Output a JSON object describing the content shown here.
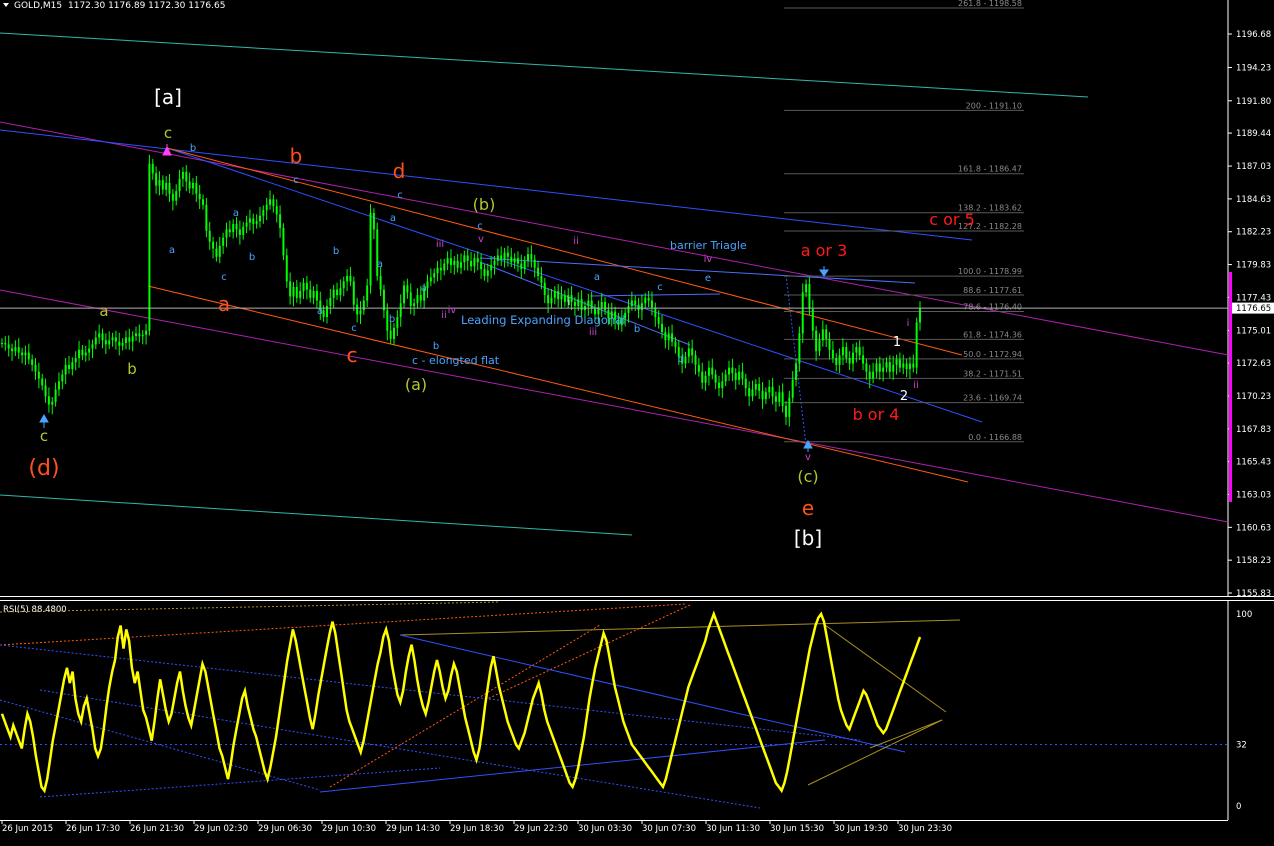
{
  "window": {
    "title": "GOLD,M15",
    "ohlc": "1172.30 1176.89 1172.30 1176.65",
    "menu_icon": "triangle-down-icon"
  },
  "colors": {
    "background": "#000000",
    "candle": "#00ff00",
    "axis": "#ffffff",
    "rsi_line": "#ffff00",
    "current_price_bg": "#ffffff",
    "fib_line": "#6e6e6e",
    "sidebar_marker": "#ff00ff"
  },
  "chart_data": [
    {
      "type": "candlestick",
      "title": "GOLD,M15",
      "ylim": [
        1155.83,
        1199.5
      ],
      "price_axis_ticks": [
        "1196.68",
        "1194.23",
        "1191.80",
        "1189.44",
        "1187.03",
        "1184.63",
        "1182.23",
        "1179.83",
        "1177.43",
        "1175.01",
        "1172.63",
        "1170.23",
        "1167.83",
        "1165.43",
        "1163.03",
        "1160.63",
        "1158.23",
        "1155.83"
      ],
      "current_price": "1176.65",
      "current_price_value": 1176.65,
      "time_labels": [
        "26 Jun 2015",
        "26 Jun 17:30",
        "26 Jun 21:30",
        "29 Jun 02:30",
        "29 Jun 06:30",
        "29 Jun 10:30",
        "29 Jun 14:30",
        "29 Jun 18:30",
        "29 Jun 22:30",
        "30 Jun 03:30",
        "30 Jun 07:30",
        "30 Jun 11:30",
        "30 Jun 15:30",
        "30 Jun 19:30",
        "30 Jun 23:30"
      ],
      "close_series": [
        1174.1,
        1174.0,
        1173.7,
        1173.5,
        1173.8,
        1173.4,
        1173.2,
        1173.4,
        1172.9,
        1172.5,
        1172.0,
        1171.5,
        1171.0,
        1170.2,
        1169.6,
        1169.8,
        1170.7,
        1171.3,
        1171.8,
        1172.5,
        1172.2,
        1172.7,
        1173.0,
        1173.6,
        1173.2,
        1173.4,
        1173.7,
        1174.0,
        1174.5,
        1174.8,
        1174.3,
        1174.0,
        1174.3,
        1174.5,
        1174.2,
        1173.9,
        1174.1,
        1174.5,
        1174.2,
        1174.6,
        1174.8,
        1174.6,
        1174.7,
        1175.0,
        1187.2,
        1186.5,
        1185.6,
        1186.0,
        1185.3,
        1185.8,
        1185.0,
        1184.5,
        1185.2,
        1186.1,
        1186.6,
        1185.9,
        1185.4,
        1185.8,
        1185.0,
        1184.6,
        1184.2,
        1182.3,
        1181.5,
        1181.0,
        1180.4,
        1181.2,
        1181.8,
        1182.4,
        1182.2,
        1182.8,
        1182.4,
        1182.0,
        1182.6,
        1182.9,
        1183.2,
        1182.8,
        1183.0,
        1183.4,
        1183.8,
        1184.2,
        1184.6,
        1184.1,
        1183.5,
        1182.5,
        1180.5,
        1178.6,
        1177.5,
        1178.2,
        1177.4,
        1177.9,
        1178.5,
        1178.0,
        1177.4,
        1177.9,
        1177.2,
        1176.5,
        1176.0,
        1176.8,
        1177.4,
        1178.0,
        1177.6,
        1178.1,
        1178.6,
        1179.0,
        1178.6,
        1176.9,
        1176.2,
        1176.5,
        1177.2,
        1178.3,
        1183.6,
        1182.4,
        1179.0,
        1178.0,
        1176.5,
        1175.0,
        1174.4,
        1175.2,
        1176.0,
        1177.0,
        1178.3,
        1177.8,
        1176.8,
        1177.0,
        1177.6,
        1177.2,
        1178.1,
        1178.6,
        1178.9,
        1179.2,
        1179.6,
        1179.4,
        1179.9,
        1180.3,
        1179.8,
        1180.1,
        1179.6,
        1180.0,
        1180.5,
        1180.1,
        1179.7,
        1180.3,
        1180.0,
        1179.5,
        1179.0,
        1179.4,
        1179.8,
        1180.1,
        1180.5,
        1180.2,
        1180.7,
        1180.4,
        1180.0,
        1180.3,
        1179.9,
        1179.5,
        1180.1,
        1180.6,
        1180.2,
        1179.6,
        1179.0,
        1178.5,
        1177.6,
        1177.0,
        1177.4,
        1177.9,
        1177.3,
        1177.6,
        1177.1,
        1177.6,
        1177.1,
        1176.8,
        1177.3,
        1176.5,
        1176.8,
        1177.2,
        1176.6,
        1176.2,
        1176.7,
        1177.1,
        1176.5,
        1175.9,
        1176.4,
        1175.8,
        1175.4,
        1175.9,
        1176.3,
        1176.8,
        1177.2,
        1176.9,
        1176.5,
        1177.0,
        1177.4,
        1177.2,
        1176.7,
        1176.0,
        1175.5,
        1174.9,
        1174.3,
        1174.8,
        1174.2,
        1173.8,
        1173.1,
        1172.6,
        1173.1,
        1173.7,
        1173.2,
        1172.5,
        1172.0,
        1171.2,
        1171.7,
        1172.3,
        1171.8,
        1171.2,
        1170.8,
        1171.3,
        1171.8,
        1172.3,
        1171.9,
        1171.4,
        1172.0,
        1171.5,
        1170.8,
        1170.2,
        1170.7,
        1171.1,
        1170.6,
        1170.0,
        1170.5,
        1170.9,
        1170.2,
        1169.8,
        1170.5,
        1169.5,
        1168.7,
        1170.1,
        1171.4,
        1172.6,
        1174.8,
        1177.8,
        1178.4,
        1176.6,
        1175.0,
        1173.5,
        1174.3,
        1175.1,
        1174.4,
        1173.6,
        1173.0,
        1172.5,
        1173.2,
        1173.8,
        1173.0,
        1172.6,
        1173.4,
        1173.8,
        1173.2,
        1172.6,
        1172.0,
        1171.5,
        1172.0,
        1172.6,
        1172.0,
        1172.3,
        1172.7,
        1172.0,
        1172.5,
        1172.9,
        1172.3,
        1172.6,
        1172.2,
        1172.6,
        1172.3,
        1175.6,
        1176.65
      ],
      "waves": {
        "bracket_a": "[a]",
        "bracket_b": "[b]",
        "red_b": "b",
        "red_d": "d",
        "red_a": "a",
        "red_c": "c",
        "red_e": "e",
        "orange_d": "(d)",
        "olive_c_top": "c",
        "olive_a": "a",
        "olive_b": "b",
        "olive_c_low": "c",
        "olive_b_paren": "(b)",
        "olive_a_paren": "(a)",
        "olive_c_paren": "(c)",
        "a_or_3": "a or 3",
        "b_or_4": "b or 4",
        "c_or_5": "c or 5",
        "wave_1": "1",
        "wave_2": "2",
        "wave_i": "i",
        "wave_ii": "ii",
        "barrier": "barrier Triagle",
        "diagonal": "Leading Expanding Diagonal",
        "flat": "c - elongted flat"
      },
      "small_labels": [
        {
          "t": "b",
          "c": "#4aa3ff",
          "x": 193,
          "y": 151
        },
        {
          "t": "c",
          "c": "#4aa3ff",
          "x": 296,
          "y": 183
        },
        {
          "t": "a",
          "c": "#4aa3ff",
          "x": 236,
          "y": 216
        },
        {
          "t": "a",
          "c": "#4aa3ff",
          "x": 172,
          "y": 253
        },
        {
          "t": "b",
          "c": "#4aa3ff",
          "x": 252,
          "y": 260
        },
        {
          "t": "c",
          "c": "#4aa3ff",
          "x": 224,
          "y": 280
        },
        {
          "t": "b",
          "c": "#4aa3ff",
          "x": 336,
          "y": 254
        },
        {
          "t": "a",
          "c": "#4aa3ff",
          "x": 380,
          "y": 267
        },
        {
          "t": "a",
          "c": "#4aa3ff",
          "x": 320,
          "y": 314
        },
        {
          "t": "c",
          "c": "#4aa3ff",
          "x": 354,
          "y": 331
        },
        {
          "t": "b",
          "c": "#4aa3ff",
          "x": 392,
          "y": 322
        },
        {
          "t": "c",
          "c": "#4aa3ff",
          "x": 400,
          "y": 198
        },
        {
          "t": "a",
          "c": "#4aa3ff",
          "x": 393,
          "y": 221
        },
        {
          "t": "a",
          "c": "#4aa3ff",
          "x": 424,
          "y": 291
        },
        {
          "t": "b",
          "c": "#4aa3ff",
          "x": 436,
          "y": 349
        },
        {
          "t": "iii",
          "c": "#cc44cc",
          "x": 440,
          "y": 247
        },
        {
          "t": "iv",
          "c": "#cc44cc",
          "x": 452,
          "y": 313
        },
        {
          "t": "ii",
          "c": "#cc44cc",
          "x": 444,
          "y": 318
        },
        {
          "t": "c",
          "c": "#4aa3ff",
          "x": 480,
          "y": 229
        },
        {
          "t": "v",
          "c": "#cc44cc",
          "x": 481,
          "y": 242
        },
        {
          "t": "ii",
          "c": "#cc44cc",
          "x": 576,
          "y": 244
        },
        {
          "t": "a",
          "c": "#4aa3ff",
          "x": 597,
          "y": 280
        },
        {
          "t": "i",
          "c": "#ffffff",
          "x": 569,
          "y": 305
        },
        {
          "t": "iii",
          "c": "#cc44cc",
          "x": 593,
          "y": 335
        },
        {
          "t": "b",
          "c": "#4aa3ff",
          "x": 637,
          "y": 332
        },
        {
          "t": "c",
          "c": "#4aa3ff",
          "x": 660,
          "y": 290
        },
        {
          "t": "iv",
          "c": "#cc44cc",
          "x": 708,
          "y": 262
        },
        {
          "t": "e",
          "c": "#4aa3ff",
          "x": 708,
          "y": 281
        },
        {
          "t": "d",
          "c": "#4aa3ff",
          "x": 681,
          "y": 362
        },
        {
          "t": "v",
          "c": "#cc44cc",
          "x": 808,
          "y": 460
        },
        {
          "t": "i",
          "c": "#cc44cc",
          "x": 908,
          "y": 326
        },
        {
          "t": "ii",
          "c": "#cc44cc",
          "x": 916,
          "y": 388
        }
      ],
      "fib_levels": [
        {
          "label": "261.8 - 1198.58",
          "value": 1198.58
        },
        {
          "label": "200 - 1191.10",
          "value": 1191.1
        },
        {
          "label": "161.8 - 1186.47",
          "value": 1186.47
        },
        {
          "label": "138.2 - 1183.62",
          "value": 1183.62
        },
        {
          "label": "127.2 - 1182.28",
          "value": 1182.28
        },
        {
          "label": "100.0 - 1178.99",
          "value": 1178.99
        },
        {
          "label": "88.6 - 1177.61",
          "value": 1177.61
        },
        {
          "label": "78.6 - 1176.40",
          "value": 1176.4
        },
        {
          "label": "61.8 - 1174.36",
          "value": 1174.36
        },
        {
          "label": "50.0 - 1172.94",
          "value": 1172.94
        },
        {
          "label": "38.2 - 1171.51",
          "value": 1171.51
        },
        {
          "label": "23.6 - 1169.74",
          "value": 1169.74
        },
        {
          "label": "0.0 - 1166.88",
          "value": 1166.88
        }
      ]
    },
    {
      "type": "line",
      "title": "RSI(5) 88.4800",
      "ylim": [
        0,
        100
      ],
      "y_ticks": [
        "100",
        "32",
        "0"
      ],
      "level": 32,
      "values": [
        48,
        44,
        40,
        36,
        42,
        38,
        34,
        30,
        40,
        48,
        44,
        36,
        26,
        18,
        10,
        8,
        14,
        24,
        34,
        42,
        50,
        58,
        66,
        72,
        64,
        70,
        56,
        48,
        44,
        52,
        56,
        48,
        40,
        30,
        26,
        30,
        40,
        52,
        62,
        70,
        76,
        88,
        94,
        82,
        92,
        86,
        72,
        64,
        70,
        60,
        50,
        46,
        40,
        34,
        44,
        56,
        66,
        58,
        50,
        44,
        48,
        56,
        64,
        70,
        60,
        52,
        46,
        42,
        50,
        58,
        66,
        74,
        70,
        62,
        54,
        46,
        38,
        30,
        26,
        20,
        14,
        22,
        32,
        40,
        48,
        56,
        60,
        52,
        46,
        40,
        36,
        30,
        24,
        18,
        14,
        20,
        28,
        36,
        46,
        56,
        66,
        76,
        84,
        92,
        86,
        78,
        70,
        62,
        54,
        46,
        40,
        48,
        58,
        66,
        74,
        82,
        90,
        96,
        90,
        80,
        70,
        60,
        50,
        44,
        40,
        36,
        32,
        28,
        34,
        42,
        50,
        58,
        66,
        74,
        80,
        88,
        92,
        86,
        74,
        66,
        58,
        54,
        60,
        70,
        78,
        84,
        76,
        66,
        58,
        52,
        48,
        54,
        62,
        70,
        76,
        70,
        62,
        56,
        60,
        68,
        74,
        70,
        62,
        54,
        46,
        40,
        34,
        28,
        24,
        30,
        40,
        52,
        62,
        72,
        78,
        70,
        62,
        56,
        50,
        44,
        40,
        36,
        32,
        30,
        34,
        38,
        44,
        50,
        56,
        60,
        64,
        58,
        50,
        44,
        40,
        36,
        32,
        28,
        24,
        20,
        16,
        12,
        10,
        14,
        20,
        28,
        36,
        46,
        56,
        64,
        72,
        78,
        84,
        90,
        86,
        78,
        70,
        62,
        56,
        50,
        44,
        40,
        36,
        32,
        30,
        28,
        26,
        24,
        22,
        20,
        18,
        16,
        14,
        12,
        10,
        14,
        20,
        26,
        32,
        38,
        44,
        50,
        56,
        62,
        66,
        70,
        74,
        78,
        82,
        86,
        92,
        96,
        100,
        96,
        92,
        88,
        84,
        80,
        76,
        72,
        68,
        64,
        60,
        56,
        52,
        48,
        44,
        40,
        36,
        32,
        28,
        24,
        20,
        16,
        12,
        10,
        8,
        12,
        18,
        26,
        34,
        42,
        50,
        58,
        66,
        74,
        82,
        88,
        94,
        98,
        100,
        96,
        88,
        80,
        72,
        64,
        56,
        50,
        46,
        42,
        40,
        44,
        48,
        52,
        56,
        60,
        58,
        54,
        50,
        46,
        42,
        40,
        38,
        40,
        44,
        48,
        52,
        56,
        60,
        64,
        68,
        72,
        76,
        80,
        84,
        88
      ]
    }
  ]
}
